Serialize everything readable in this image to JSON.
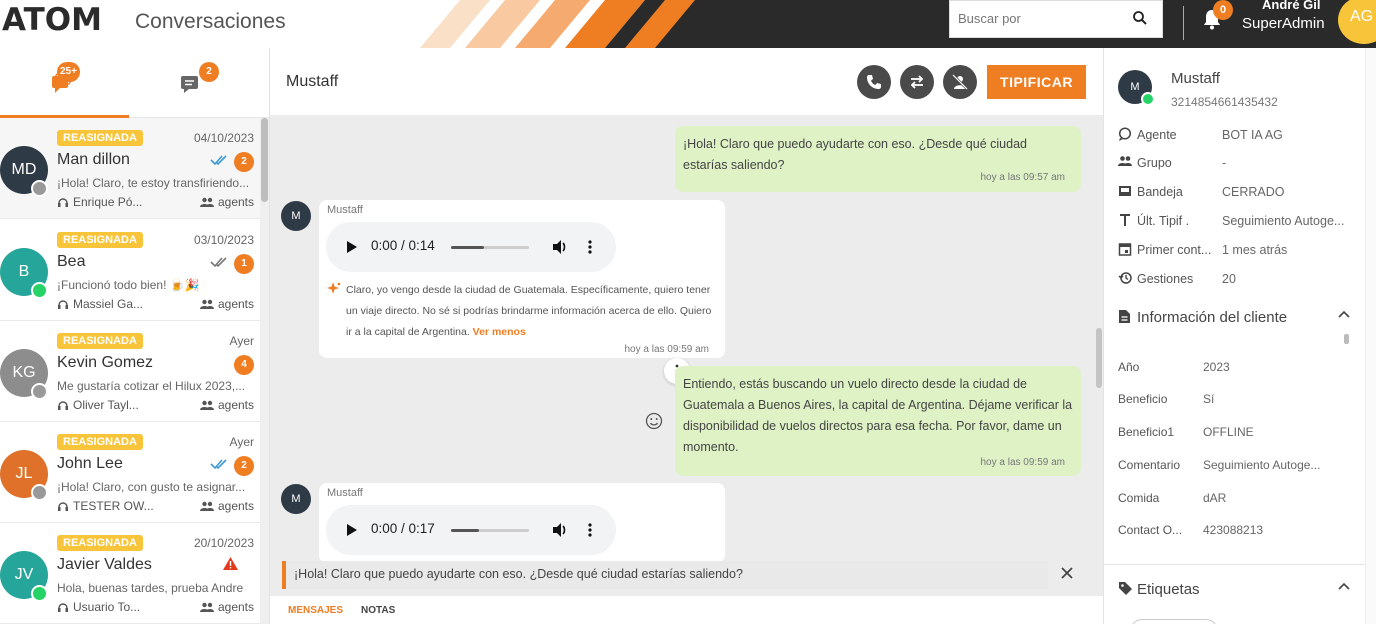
{
  "header": {
    "logo": "ATOM",
    "title": "Conversaciones",
    "search_placeholder": "Buscar por",
    "notifications_count": "0",
    "user_name": "André Gil",
    "user_role": "SuperAdmin",
    "user_initials": "AG"
  },
  "left_tabs": [
    {
      "badge": "25+"
    },
    {
      "badge": "2"
    }
  ],
  "conversations": [
    {
      "tag": "REASIGNADA",
      "date": "04/10/2023",
      "name": "Man dillon",
      "initials": "MD",
      "avatar_color": "#2e3a46",
      "channel": "agent",
      "preview": "¡Hola! Claro, te estoy transfiriendo...",
      "agent": "Enrique Pó...",
      "group": "agents",
      "unread": "2",
      "ticks_color": "#3b9bd6"
    },
    {
      "tag": "REASIGNADA",
      "date": "03/10/2023",
      "name": "Bea",
      "initials": "B",
      "avatar_color": "#26a69a",
      "channel": "whatsapp",
      "preview": "¡Funcionó todo bien! 🍺🎉",
      "agent": "Massiel Ga...",
      "group": "agents",
      "unread": "1",
      "ticks_color": "#777777"
    },
    {
      "tag": "REASIGNADA",
      "date": "Ayer",
      "name": "Kevin Gomez",
      "initials": "KG",
      "avatar_color": "#8d8d8d",
      "channel": "agent",
      "preview": "Me gustaría cotizar el Hilux 2023,...",
      "agent": "Oliver Tayl...",
      "group": "agents",
      "unread": "4",
      "ticks_color": ""
    },
    {
      "tag": "REASIGNADA",
      "date": "Ayer",
      "name": "John Lee",
      "initials": "JL",
      "avatar_color": "#e0712a",
      "channel": "agent",
      "preview": "¡Hola! Claro, con gusto te asignar...",
      "agent": "TESTER OW...",
      "group": "agents",
      "unread": "2",
      "ticks_color": "#3b9bd6"
    },
    {
      "tag": "REASIGNADA",
      "date": "20/10/2023",
      "name": "Javier Valdes",
      "initials": "JV",
      "avatar_color": "#26a69a",
      "channel": "whatsapp",
      "preview": "Hola, buenas tardes, prueba Andre",
      "agent": "Usuario To...",
      "group": "agents",
      "unread": "",
      "ticks_color": "",
      "warning": "true"
    }
  ],
  "chat": {
    "contact": "Mustaff",
    "tipificar_label": "TIPIFICAR",
    "messages": {
      "out1_text": "¡Hola! Claro que puedo ayudarte con eso. ¿Desde qué ciudad estarías saliendo?",
      "out1_time": "hoy a las 09:57 am",
      "in1_sender": "Mustaff",
      "in1_initial": "M",
      "in1_audio_time": "0:00 / 0:14",
      "in1_audio_progress": 0.42,
      "in1_transcript": "Claro, yo vengo desde la ciudad de Guatemala. Específicamente, quiero tener un viaje directo. No sé si podrías brindarme información acerca de ello. Quiero ir a la capital de Argentina.",
      "in1_toggle": "Ver menos",
      "in1_time": "hoy a las 09:59 am",
      "out2_text": "Entiendo, estás buscando un vuelo directo desde la ciudad de Guatemala a Buenos Aires, la capital de Argentina. Déjame verificar la disponibilidad de vuelos directos para esa fecha. Por favor, dame un momento.",
      "out2_time": "hoy a las 09:59 am",
      "in2_sender": "Mustaff",
      "in2_initial": "M",
      "in2_audio_time": "0:00 / 0:17",
      "in2_audio_progress": 0.36
    },
    "quote": "¡Hola! Claro que puedo ayudarte con eso. ¿Desde qué ciudad estarías saliendo?",
    "tabs": [
      "MENSAJES",
      "NOTAS"
    ]
  },
  "contact_panel": {
    "initial": "M",
    "name": "Mustaff",
    "phone": "3214854661435432",
    "details": [
      {
        "label": "Agente",
        "value": "BOT IA AG",
        "icon": "chat-bubble-icon"
      },
      {
        "label": "Grupo",
        "value": "-",
        "icon": "group-icon"
      },
      {
        "label": "Bandeja",
        "value": "CERRADO",
        "icon": "inbox-icon"
      },
      {
        "label": "Últ. Tipif .",
        "value": "Seguimiento Autoge...",
        "icon": "text-type-icon"
      },
      {
        "label": "Primer cont...",
        "value": "1 mes atrás",
        "icon": "calendar-icon"
      },
      {
        "label": "Gestiones",
        "value": "20",
        "icon": "history-icon"
      }
    ],
    "client_info_title": "Información del cliente",
    "client_info": [
      {
        "label": "Año",
        "value": "2023"
      },
      {
        "label": "Beneficio",
        "value": "Sí"
      },
      {
        "label": "Beneficio1",
        "value": "OFFLINE"
      },
      {
        "label": "Comentario",
        "value": "Seguimiento Autoge..."
      },
      {
        "label": "Comida",
        "value": "dAR"
      },
      {
        "label": "Contact O...",
        "value": "423088213"
      }
    ],
    "tags_title": "Etiquetas"
  },
  "colors": {
    "accent": "#ef7d22",
    "tag_yellow": "#f7c43a",
    "bubble_green": "#def2c6"
  }
}
